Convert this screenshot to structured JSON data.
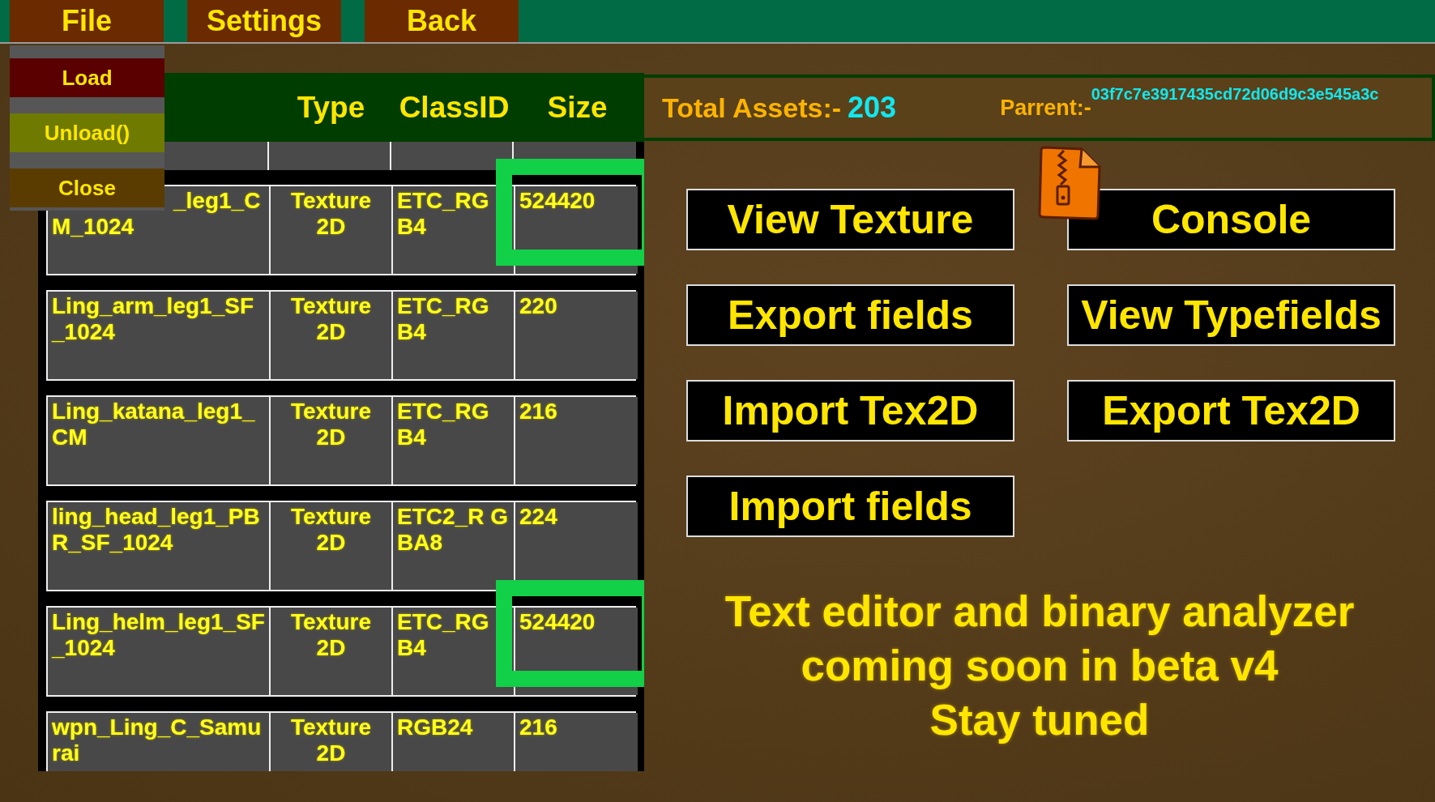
{
  "menu_bar": [
    "File",
    "Settings",
    "Back"
  ],
  "file_menu": [
    {
      "label": "Load",
      "color": "#5a0000"
    },
    {
      "label": "Unload()",
      "color": "#6f7a00"
    },
    {
      "label": "Close",
      "color": "#5a3c00"
    }
  ],
  "table": {
    "columns": [
      "Type",
      "ClassID",
      "Size"
    ],
    "rows": [
      {
        "name": "_leg1_C M_1024",
        "type": "Texture 2D",
        "class_id": "ETC_RG B4",
        "size": "524420",
        "highlighted": true
      },
      {
        "name": "Ling_arm_leg1_SF_1024",
        "type": "Texture 2D",
        "class_id": "ETC_RG B4",
        "size": "220",
        "highlighted": false
      },
      {
        "name": "Ling_katana_leg1_CM",
        "type": "Texture 2D",
        "class_id": "ETC_RG B4",
        "size": "216",
        "highlighted": false
      },
      {
        "name": "ling_head_leg1_PBR_SF_1024",
        "type": "Texture 2D",
        "class_id": "ETC2_R GBA8",
        "size": "224",
        "highlighted": false
      },
      {
        "name": "Ling_helm_leg1_SF_1024",
        "type": "Texture 2D",
        "class_id": "ETC_RG B4",
        "size": "524420",
        "highlighted": true
      },
      {
        "name": "wpn_Ling_C_Samurai",
        "type": "Texture 2D",
        "class_id": "RGB24",
        "size": "216",
        "highlighted": false
      }
    ]
  },
  "info": {
    "total_label": "Total Assets:-",
    "total_value": "203",
    "parent_label": "Parrent:-",
    "parent_value": "03f7c7e3917435cd72d06d9c3e545a3c"
  },
  "actions": [
    "View Texture",
    "Console",
    "Export fields",
    "View Typefields",
    "Import Tex2D",
    "Export Tex2D",
    "Import fields"
  ],
  "notice": [
    "Text editor and binary analyzer",
    "coming soon in beta v4",
    "Stay tuned"
  ]
}
